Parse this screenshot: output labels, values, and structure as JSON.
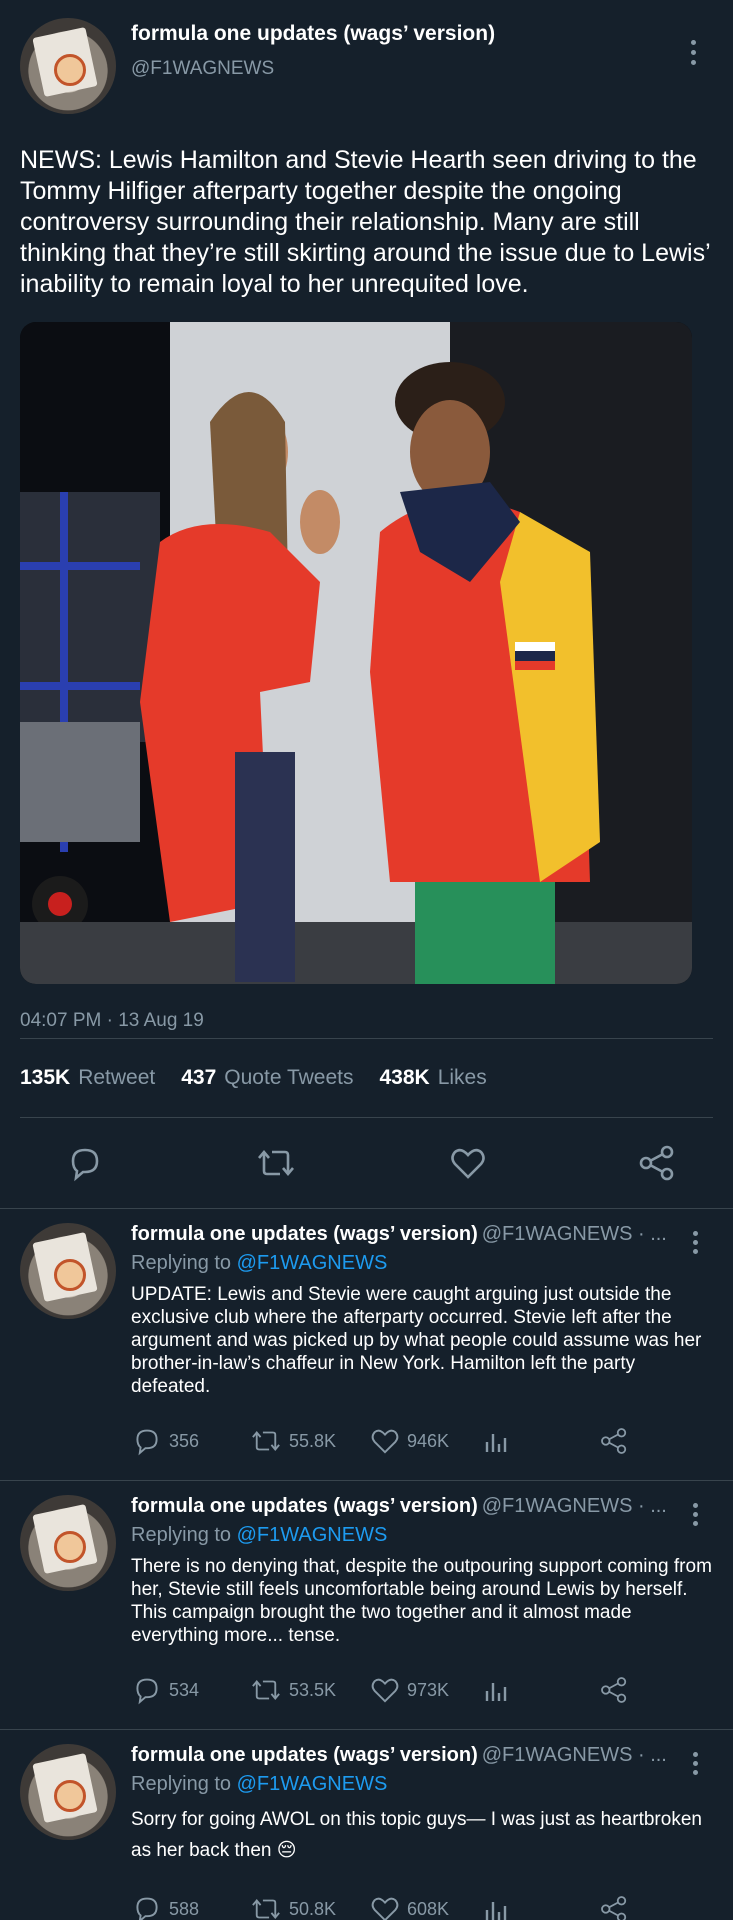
{
  "main_tweet": {
    "display_name": "formula one updates (wags’ version)",
    "handle": "@F1WAGNEWS",
    "text": "NEWS: Lewis Hamilton and Stevie Hearth seen driving to the Tommy Hilfiger afterparty together despite the ongoing controversy surrounding their relationship. Many are still thinking that they’re still skirting around the issue due to Lewis’ inability to remain loyal to her unrequited love.",
    "timestamp": "04:07 PM · 13 Aug 19",
    "stats": {
      "retweets": "135K",
      "retweets_label": "Retweet",
      "quotes": "437",
      "quotes_label": "Quote Tweets",
      "likes": "438K",
      "likes_label": "Likes"
    }
  },
  "replies": [
    {
      "display_name": "formula one updates (wags’ version)",
      "handle": "@F1WAGNEWS · ...",
      "replying_prefix": "Replying to",
      "replying_to": "@F1WAGNEWS",
      "text": "UPDATE: Lewis and Stevie were caught arguing just outside the exclusive club where the afterparty occurred. Stevie left after the argument and was picked up by what people could assume was her brother-in-law’s chaffeur in New York. Hamilton left the party defeated.",
      "replies": "356",
      "retweets": "55.8K",
      "likes": "946K"
    },
    {
      "display_name": "formula one updates (wags’ version)",
      "handle": "@F1WAGNEWS · ...",
      "replying_prefix": "Replying to",
      "replying_to": "@F1WAGNEWS",
      "text": "There is no denying that, despite the outpouring support coming from her, Stevie still feels uncomfortable being around Lewis by herself. This campaign brought the two together and it almost made everything more... tense.",
      "replies": "534",
      "retweets": "53.5K",
      "likes": "973K"
    },
    {
      "display_name": "formula one updates (wags’ version)",
      "handle": "@F1WAGNEWS · ...",
      "replying_prefix": "Replying to",
      "replying_to": "@F1WAGNEWS",
      "text": "Sorry for going AWOL on this topic guys— I was just as heartbroken as her back then 😔",
      "replies": "588",
      "retweets": "50.8K",
      "likes": "608K"
    }
  ],
  "colors": {
    "background": "#15202b",
    "secondary_text": "#8899a6",
    "link": "#1d9bf0",
    "divider": "#38444d"
  },
  "icons": [
    "more-icon",
    "reply-icon",
    "retweet-icon",
    "like-icon",
    "share-icon",
    "analytics-icon"
  ]
}
